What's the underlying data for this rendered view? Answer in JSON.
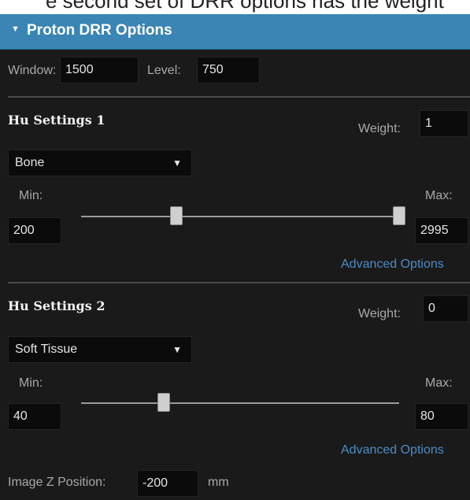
{
  "caption_fragment": "e second set of DRR options has the weight",
  "panel": {
    "collapse_glyph": "▼",
    "collapse_icon": "triangle-down-icon",
    "title": "Proton DRR Options"
  },
  "window_level": {
    "window_label": "Window:",
    "window_value": "1500",
    "level_label": "Level:",
    "level_value": "750"
  },
  "hu1": {
    "title": "Hu Settings 1",
    "weight_label": "Weight:",
    "weight_value": "1",
    "material": "Bone",
    "arrow_glyph": "▼",
    "min_label": "Min:",
    "min_value": "200",
    "max_label": "Max:",
    "max_value": "2995",
    "advanced": "Advanced Options",
    "slider": {
      "low_fraction": 0.3,
      "high_fraction": 1.0
    }
  },
  "hu2": {
    "title": "Hu Settings 2",
    "weight_label": "Weight:",
    "weight_value": "0",
    "material": "Soft Tissue",
    "arrow_glyph": "▼",
    "min_label": "Min:",
    "min_value": "40",
    "max_label": "Max:",
    "max_value": "80",
    "advanced": "Advanced Options",
    "slider": {
      "low_fraction": 0.26
    }
  },
  "image_z": {
    "label": "Image Z Position:",
    "value": "-200",
    "unit": "mm"
  },
  "colors": {
    "header": "#3a85b4",
    "panel_bg": "#1a1a1a",
    "field_bg": "#0b0b0b",
    "link": "#4d8bc4"
  }
}
